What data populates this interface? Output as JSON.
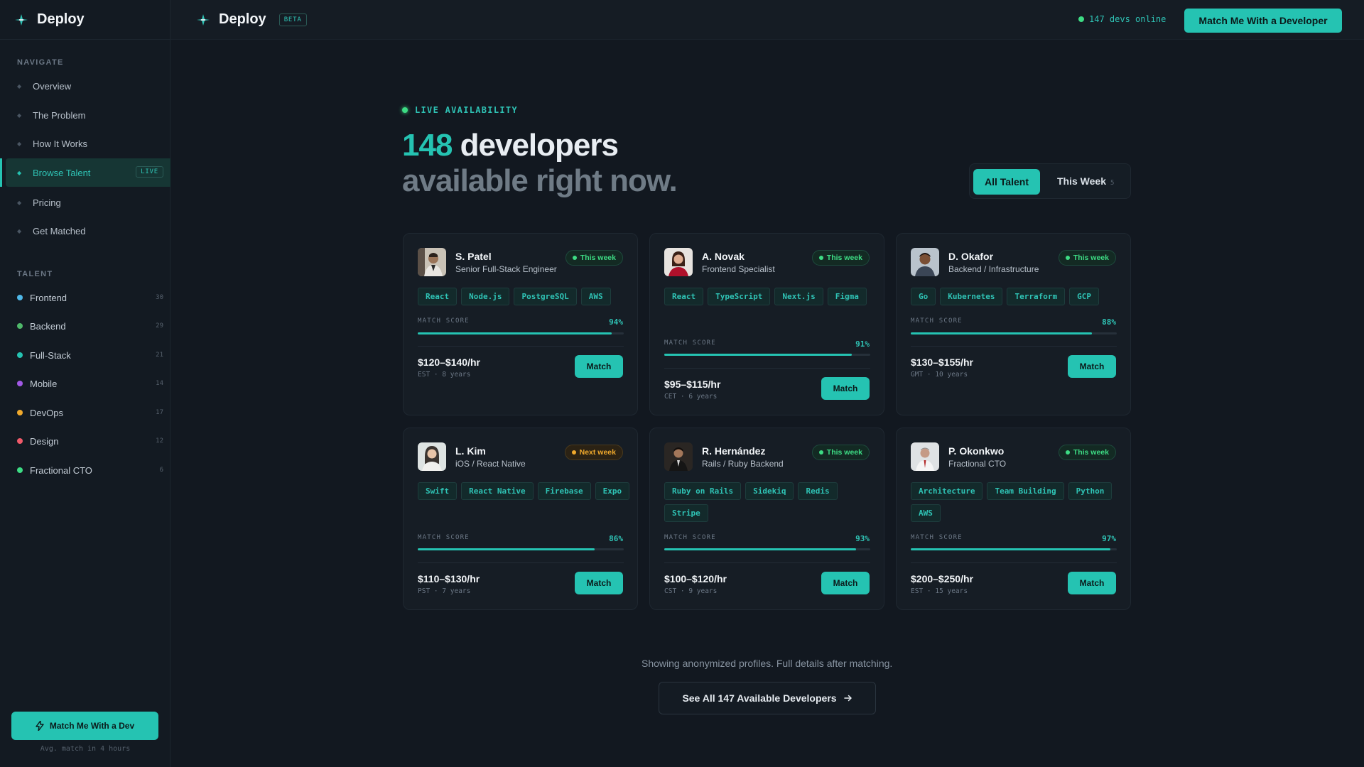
{
  "brand": {
    "name": "Deploy",
    "beta": "BETA"
  },
  "topbar": {
    "online": "147 devs online",
    "cta": "Match Me With a Developer"
  },
  "sidebar": {
    "navigate_title": "NAVIGATE",
    "nav": [
      {
        "label": "Overview"
      },
      {
        "label": "The Problem"
      },
      {
        "label": "How It Works"
      },
      {
        "label": "Browse Talent",
        "tag": "LIVE"
      },
      {
        "label": "Pricing"
      },
      {
        "label": "Get Matched"
      }
    ],
    "talent_title": "TALENT",
    "talent": [
      {
        "label": "Frontend",
        "count": "30",
        "color": "#4fb8e8"
      },
      {
        "label": "Backend",
        "count": "29",
        "color": "#4fb86a"
      },
      {
        "label": "Full-Stack",
        "count": "21",
        "color": "#25c3b2"
      },
      {
        "label": "Mobile",
        "count": "14",
        "color": "#a259e6"
      },
      {
        "label": "DevOps",
        "count": "17",
        "color": "#f0a92c"
      },
      {
        "label": "Design",
        "count": "12",
        "color": "#f05a6a"
      },
      {
        "label": "Fractional CTO",
        "count": "6",
        "color": "#3ddc84"
      }
    ],
    "cta": "Match Me With a Dev",
    "note": "Avg. match in 4 hours"
  },
  "hero": {
    "eyebrow": "LIVE AVAILABILITY",
    "count": "148",
    "line1_rest": " developers",
    "line2": "available right now."
  },
  "toggle": {
    "all": "All Talent",
    "week": "This Week",
    "week_count": "5"
  },
  "score_label": "MATCH SCORE",
  "match_label": "Match",
  "cards": [
    {
      "name": "S. Patel",
      "role": "Senior Full-Stack Engineer",
      "badge": "This week",
      "tags": [
        "React",
        "Node.js",
        "PostgreSQL",
        "AWS"
      ],
      "score": "94%",
      "score_value": 0.94,
      "rate": "$120–$140/hr",
      "meta": "EST · 8 years"
    },
    {
      "name": "A. Novak",
      "role": "Frontend Specialist",
      "badge": "This week",
      "tags": [
        "React",
        "TypeScript",
        "Next.js",
        "Figma"
      ],
      "score": "91%",
      "score_value": 0.91,
      "rate": "$95–$115/hr",
      "meta": "CET · 6 years"
    },
    {
      "name": "D. Okafor",
      "role": "Backend / Infrastructure",
      "badge": "This week",
      "tags": [
        "Go",
        "Kubernetes",
        "Terraform",
        "GCP"
      ],
      "score": "88%",
      "score_value": 0.88,
      "rate": "$130–$155/hr",
      "meta": "GMT · 10 years"
    },
    {
      "name": "L. Kim",
      "role": "iOS / React Native",
      "badge": "Next week",
      "tags": [
        "Swift",
        "React Native",
        "Firebase",
        "Expo"
      ],
      "score": "86%",
      "score_value": 0.86,
      "rate": "$110–$130/hr",
      "meta": "PST · 7 years"
    },
    {
      "name": "R. Hernández",
      "role": "Rails / Ruby Backend",
      "badge": "This week",
      "tags": [
        "Ruby on Rails",
        "Sidekiq",
        "Redis",
        "Stripe"
      ],
      "score": "93%",
      "score_value": 0.93,
      "rate": "$100–$120/hr",
      "meta": "CST · 9 years"
    },
    {
      "name": "P. Okonkwo",
      "role": "Fractional CTO",
      "badge": "This week",
      "tags": [
        "Architecture",
        "Team Building",
        "Python",
        "AWS"
      ],
      "score": "97%",
      "score_value": 0.97,
      "rate": "$200–$250/hr",
      "meta": "EST · 15 years"
    }
  ],
  "footer": {
    "note": "Showing anonymized profiles. Full details after matching.",
    "see_all": "See All 147 Available Developers"
  }
}
